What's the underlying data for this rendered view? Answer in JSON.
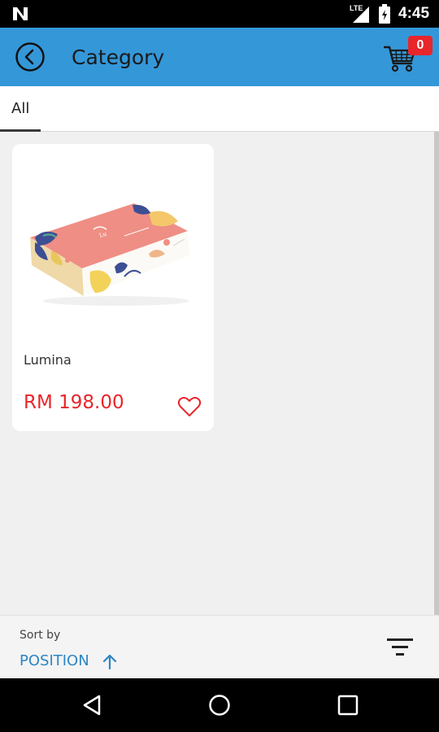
{
  "status_bar": {
    "network": "LTE",
    "time": "4:45",
    "icons": [
      "n-icon",
      "signal-icon",
      "battery-icon"
    ]
  },
  "app_bar": {
    "title": "Category",
    "cart_count": "0",
    "color": "#3497d8",
    "icons": [
      "back-icon",
      "cart-icon"
    ]
  },
  "tabs": [
    {
      "label": "All",
      "selected": true
    }
  ],
  "products": [
    {
      "name": "Lumina",
      "price": "RM 198.00",
      "image": "tissue-box-image",
      "favorited": false
    }
  ],
  "sort_bar": {
    "label": "Sort by",
    "value": "POSITION",
    "direction": "ascending",
    "icons": [
      "arrow-up-icon",
      "filter-icon"
    ]
  },
  "nav_bar": {
    "icons": [
      "nav-back-icon",
      "nav-home-icon",
      "nav-recents-icon"
    ]
  },
  "colors": {
    "accent": "#3497d8",
    "price": "#e8262b",
    "sort_value": "#2d86c4"
  }
}
